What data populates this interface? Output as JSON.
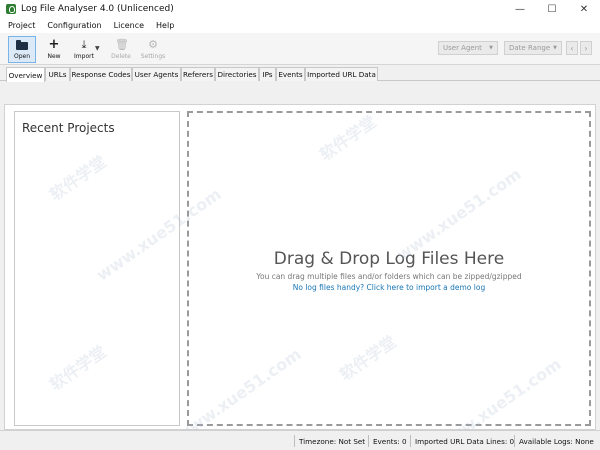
{
  "window": {
    "title": "Log File Analyser 4.0 (Unlicenced)",
    "controls": {
      "minimize": "—",
      "maximize": "☐",
      "close": "✕"
    }
  },
  "menu": {
    "items": [
      "Project",
      "Configuration",
      "Licence",
      "Help"
    ]
  },
  "toolbar": {
    "open": "Open",
    "new": "New",
    "import": "Import",
    "delete": "Delete",
    "settings": "Settings",
    "user_agent": "User Agent",
    "date_range": "Date Range",
    "prev": "‹",
    "next": "›"
  },
  "tabs": [
    "Overview",
    "URLs",
    "Response Codes",
    "User Agents",
    "Referers",
    "Directories",
    "IPs",
    "Events",
    "Imported URL Data"
  ],
  "recent_projects": {
    "title": "Recent Projects"
  },
  "dropzone": {
    "title": "Drag & Drop Log Files Here",
    "subtitle": "You can drag multiple files and/or folders which can be zipped/gzipped",
    "link": "No log files handy? Click here to import a demo log"
  },
  "statusbar": {
    "timezone": "Timezone:  Not Set",
    "events": "Events:  0",
    "imported_lines": "Imported URL Data Lines:  0",
    "available_logs": "Available Logs:  None"
  },
  "watermark": {
    "text1": "软件学堂",
    "text2": "www.xue51.com"
  }
}
